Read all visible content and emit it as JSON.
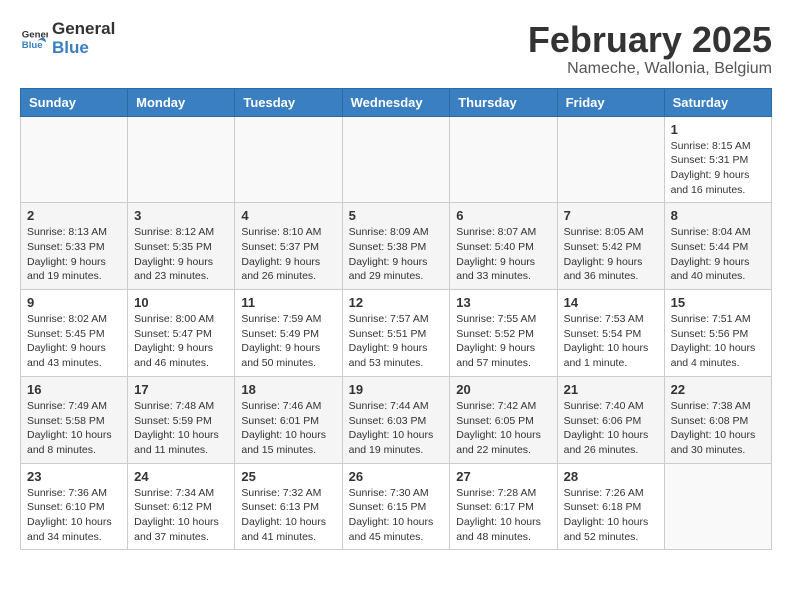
{
  "header": {
    "logo_general": "General",
    "logo_blue": "Blue",
    "month": "February 2025",
    "location": "Nameche, Wallonia, Belgium"
  },
  "days_of_week": [
    "Sunday",
    "Monday",
    "Tuesday",
    "Wednesday",
    "Thursday",
    "Friday",
    "Saturday"
  ],
  "weeks": [
    [
      {
        "day": "",
        "info": ""
      },
      {
        "day": "",
        "info": ""
      },
      {
        "day": "",
        "info": ""
      },
      {
        "day": "",
        "info": ""
      },
      {
        "day": "",
        "info": ""
      },
      {
        "day": "",
        "info": ""
      },
      {
        "day": "1",
        "info": "Sunrise: 8:15 AM\nSunset: 5:31 PM\nDaylight: 9 hours and 16 minutes."
      }
    ],
    [
      {
        "day": "2",
        "info": "Sunrise: 8:13 AM\nSunset: 5:33 PM\nDaylight: 9 hours and 19 minutes."
      },
      {
        "day": "3",
        "info": "Sunrise: 8:12 AM\nSunset: 5:35 PM\nDaylight: 9 hours and 23 minutes."
      },
      {
        "day": "4",
        "info": "Sunrise: 8:10 AM\nSunset: 5:37 PM\nDaylight: 9 hours and 26 minutes."
      },
      {
        "day": "5",
        "info": "Sunrise: 8:09 AM\nSunset: 5:38 PM\nDaylight: 9 hours and 29 minutes."
      },
      {
        "day": "6",
        "info": "Sunrise: 8:07 AM\nSunset: 5:40 PM\nDaylight: 9 hours and 33 minutes."
      },
      {
        "day": "7",
        "info": "Sunrise: 8:05 AM\nSunset: 5:42 PM\nDaylight: 9 hours and 36 minutes."
      },
      {
        "day": "8",
        "info": "Sunrise: 8:04 AM\nSunset: 5:44 PM\nDaylight: 9 hours and 40 minutes."
      }
    ],
    [
      {
        "day": "9",
        "info": "Sunrise: 8:02 AM\nSunset: 5:45 PM\nDaylight: 9 hours and 43 minutes."
      },
      {
        "day": "10",
        "info": "Sunrise: 8:00 AM\nSunset: 5:47 PM\nDaylight: 9 hours and 46 minutes."
      },
      {
        "day": "11",
        "info": "Sunrise: 7:59 AM\nSunset: 5:49 PM\nDaylight: 9 hours and 50 minutes."
      },
      {
        "day": "12",
        "info": "Sunrise: 7:57 AM\nSunset: 5:51 PM\nDaylight: 9 hours and 53 minutes."
      },
      {
        "day": "13",
        "info": "Sunrise: 7:55 AM\nSunset: 5:52 PM\nDaylight: 9 hours and 57 minutes."
      },
      {
        "day": "14",
        "info": "Sunrise: 7:53 AM\nSunset: 5:54 PM\nDaylight: 10 hours and 1 minute."
      },
      {
        "day": "15",
        "info": "Sunrise: 7:51 AM\nSunset: 5:56 PM\nDaylight: 10 hours and 4 minutes."
      }
    ],
    [
      {
        "day": "16",
        "info": "Sunrise: 7:49 AM\nSunset: 5:58 PM\nDaylight: 10 hours and 8 minutes."
      },
      {
        "day": "17",
        "info": "Sunrise: 7:48 AM\nSunset: 5:59 PM\nDaylight: 10 hours and 11 minutes."
      },
      {
        "day": "18",
        "info": "Sunrise: 7:46 AM\nSunset: 6:01 PM\nDaylight: 10 hours and 15 minutes."
      },
      {
        "day": "19",
        "info": "Sunrise: 7:44 AM\nSunset: 6:03 PM\nDaylight: 10 hours and 19 minutes."
      },
      {
        "day": "20",
        "info": "Sunrise: 7:42 AM\nSunset: 6:05 PM\nDaylight: 10 hours and 22 minutes."
      },
      {
        "day": "21",
        "info": "Sunrise: 7:40 AM\nSunset: 6:06 PM\nDaylight: 10 hours and 26 minutes."
      },
      {
        "day": "22",
        "info": "Sunrise: 7:38 AM\nSunset: 6:08 PM\nDaylight: 10 hours and 30 minutes."
      }
    ],
    [
      {
        "day": "23",
        "info": "Sunrise: 7:36 AM\nSunset: 6:10 PM\nDaylight: 10 hours and 34 minutes."
      },
      {
        "day": "24",
        "info": "Sunrise: 7:34 AM\nSunset: 6:12 PM\nDaylight: 10 hours and 37 minutes."
      },
      {
        "day": "25",
        "info": "Sunrise: 7:32 AM\nSunset: 6:13 PM\nDaylight: 10 hours and 41 minutes."
      },
      {
        "day": "26",
        "info": "Sunrise: 7:30 AM\nSunset: 6:15 PM\nDaylight: 10 hours and 45 minutes."
      },
      {
        "day": "27",
        "info": "Sunrise: 7:28 AM\nSunset: 6:17 PM\nDaylight: 10 hours and 48 minutes."
      },
      {
        "day": "28",
        "info": "Sunrise: 7:26 AM\nSunset: 6:18 PM\nDaylight: 10 hours and 52 minutes."
      },
      {
        "day": "",
        "info": ""
      }
    ]
  ]
}
